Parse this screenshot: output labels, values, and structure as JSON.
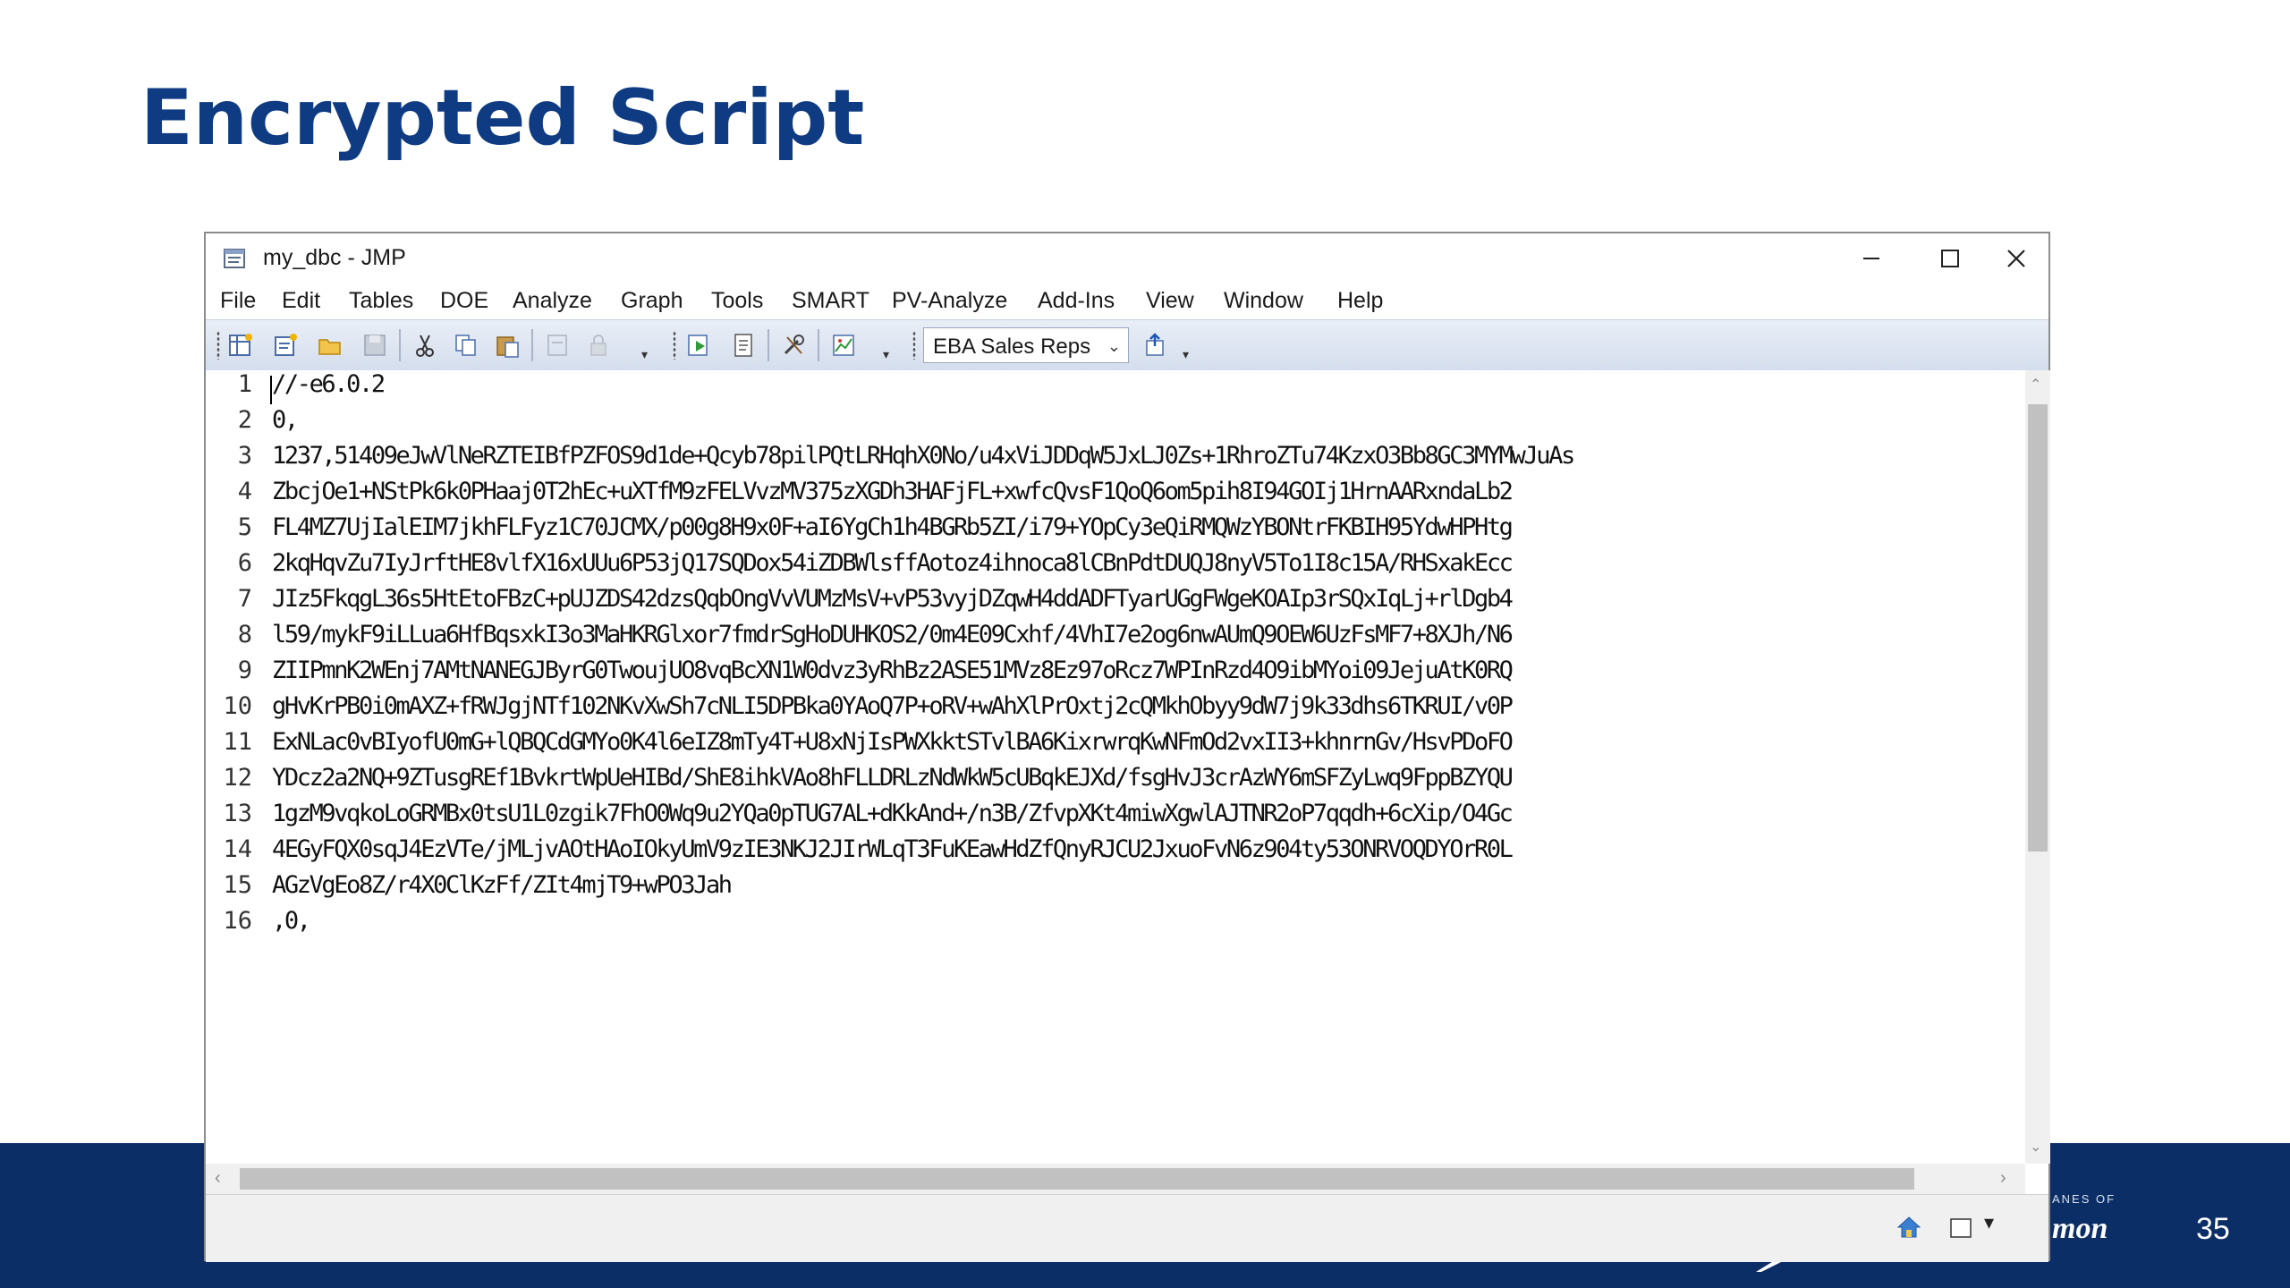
{
  "slide": {
    "title": "Encrypted Script",
    "page_number": "35",
    "footer_logo_small": "ANES OF",
    "footer_logo": "mon"
  },
  "window": {
    "title": "my_dbc - JMP",
    "controls": {
      "minimize": "—",
      "maximize": "☐",
      "close": "✕"
    }
  },
  "menu": [
    "File",
    "Edit",
    "Tables",
    "DOE",
    "Analyze",
    "Graph",
    "Tools",
    "SMART",
    "PV-Analyze",
    "Add-Ins",
    "View",
    "Window",
    "Help"
  ],
  "toolbar": {
    "combo_value": "EBA Sales Reps",
    "icons": [
      "new-data-table-icon",
      "new-script-icon",
      "open-icon",
      "save-icon",
      "cut-icon",
      "copy-icon",
      "paste-icon",
      "data-view-icon",
      "lock-icon",
      "run-script-icon",
      "log-icon",
      "tools-icon",
      "graph-builder-icon",
      "insert-icon"
    ]
  },
  "editor": {
    "lines": [
      {
        "n": "1",
        "text": "//-e6.0.2"
      },
      {
        "n": "2",
        "text": "0,"
      },
      {
        "n": "3",
        "text": "1237,51409eJwVlNeRZTEIBfPZFOS9d1de+Qcyb78pilPQtLRHqhX0No/u4xViJDDqW5JxLJ0Zs+1RhroZTu74KzxO3Bb8GC3MYMwJuAs"
      },
      {
        "n": "4",
        "text": "ZbcjOe1+NStPk6k0PHaaj0T2hEc+uXTfM9zFELVvzMV375zXGDh3HAFjFL+xwfcQvsF1QoQ6om5pih8I94GOIj1HrnAARxndaLb2"
      },
      {
        "n": "5",
        "text": "FL4MZ7UjIalEIM7jkhFLFyz1C70JCMX/p00g8H9x0F+aI6YgCh1h4BGRb5ZI/i79+YOpCy3eQiRMQWzYBONtrFKBIH95YdwHPHtg"
      },
      {
        "n": "6",
        "text": "2kqHqvZu7IyJrftHE8vlfX16xUUu6P53jQ17SQDox54iZDBWlsffAotoz4ihnoca8lCBnPdtDUQJ8nyV5To1I8c15A/RHSxakEcc"
      },
      {
        "n": "7",
        "text": "JIz5FkqgL36s5HtEtoFBzC+pUJZDS42dzsQqbOngVvVUMzMsV+vP53vyjDZqwH4ddADFTyarUGgFWgeKOAIp3rSQxIqLj+rlDgb4"
      },
      {
        "n": "8",
        "text": "l59/mykF9iLLua6HfBqsxkI3o3MaHKRGlxor7fmdrSgHoDUHKOS2/0m4E09Cxhf/4VhI7e2og6nwAUmQ9OEW6UzFsMF7+8XJh/N6"
      },
      {
        "n": "9",
        "text": "ZIIPmnK2WEnj7AMtNANEGJByrG0TwoujUO8vqBcXN1W0dvz3yRhBz2ASE51MVz8Ez97oRcz7WPInRzd4O9ibMYoi09JejuAtK0RQ"
      },
      {
        "n": "10",
        "text": "gHvKrPB0i0mAXZ+fRWJgjNTf102NKvXwSh7cNLI5DPBka0YAoQ7P+oRV+wAhXlPrOxtj2cQMkhObyy9dW7j9k33dhs6TKRUI/v0P"
      },
      {
        "n": "11",
        "text": "ExNLac0vBIyofU0mG+lQBQCdGMYo0K4l6eIZ8mTy4T+U8xNjIsPWXkktSTvlBA6KixrwrqKwNFmOd2vxII3+khnrnGv/HsvPDoFO"
      },
      {
        "n": "12",
        "text": "YDcz2a2NQ+9ZTusgREf1BvkrtWpUeHIBd/ShE8ihkVAo8hFLLDRLzNdWkW5cUBqkEJXd/fsgHvJ3crAzWY6mSFZyLwq9FppBZYQU"
      },
      {
        "n": "13",
        "text": "1gzM9vqkoLoGRMBx0tsU1L0zgik7FhO0Wq9u2YQa0pTUG7AL+dKkAnd+/n3B/ZfvpXKt4miwXgwlAJTNR2oP7qqdh+6cXip/O4Gc"
      },
      {
        "n": "14",
        "text": "4EGyFQX0sqJ4EzVTe/jMLjvAOtHAoIOkyUmV9zIE3NKJ2JIrWLqT3FuKEawHdZfQnyRJCU2JxuoFvN6z904ty53ONRVOQDYOrR0L"
      },
      {
        "n": "15",
        "text": "AGzVgEo8Z/r4X0ClKzFf/ZIt4mjT9+wPO3Jah"
      },
      {
        "n": "16",
        "text": ",0,"
      }
    ]
  },
  "colors": {
    "title": "#0f3b82",
    "footer": "#0c2e67",
    "toolbar": "#dbe3f0"
  }
}
